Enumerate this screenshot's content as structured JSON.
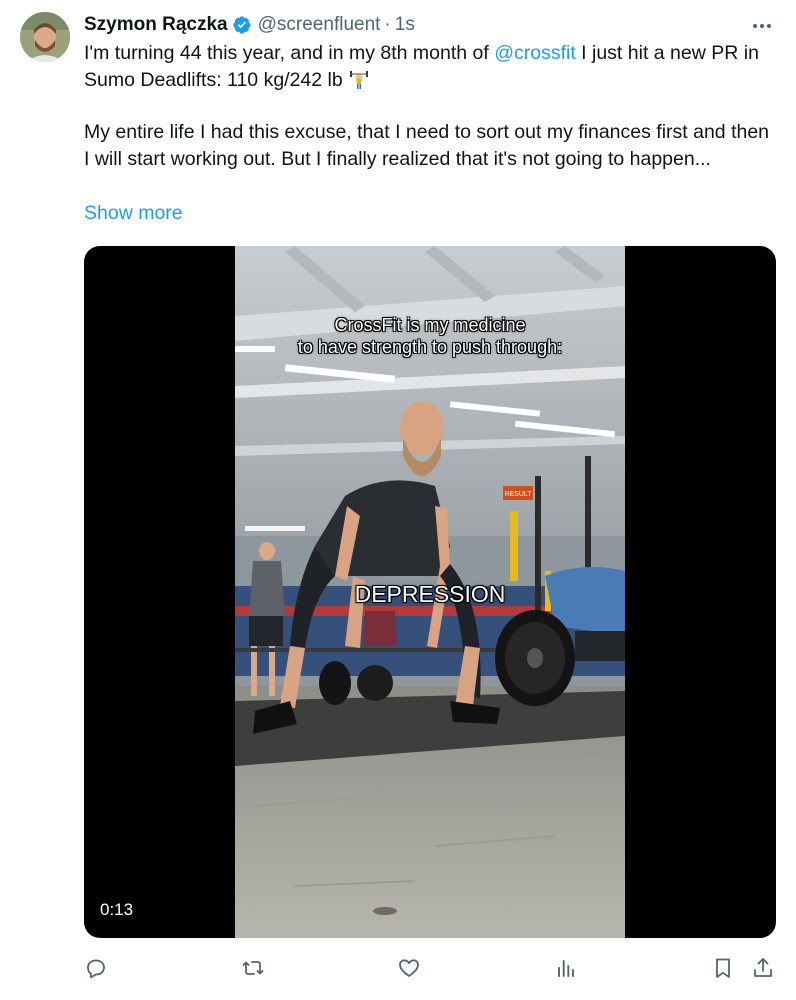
{
  "author": {
    "name": "Szymon Rączka",
    "handle": "@screenfluent",
    "separator": "·",
    "time": "1s"
  },
  "tweet": {
    "line1_pre": "I'm turning 44 this year, and in my 8th month of ",
    "mention": "@crossfit",
    "line1_post": " I just hit a new PR in Sumo Deadlifts: 110 kg/242 lb ",
    "paragraph2": "My entire life I had this excuse, that I need to sort out my finances first and then I will start working out. But I finally realized that it's not going to happen...",
    "show_more": "Show more"
  },
  "video": {
    "caption_top_line1": "CrossFit is my medicine",
    "caption_top_line2": "to have strength to push through:",
    "caption_middle": "DEPRESSION",
    "duration": "0:13",
    "sign_text": "RESULT"
  },
  "icons": {
    "verified": "verified-badge-icon",
    "more": "more-icon",
    "reply": "reply-icon",
    "retweet": "retweet-icon",
    "like": "like-icon",
    "views": "views-icon",
    "bookmark": "bookmark-icon",
    "share": "share-icon"
  },
  "colors": {
    "accent": "#1d9bf0",
    "text": "#0f1419",
    "secondary": "#536471"
  }
}
